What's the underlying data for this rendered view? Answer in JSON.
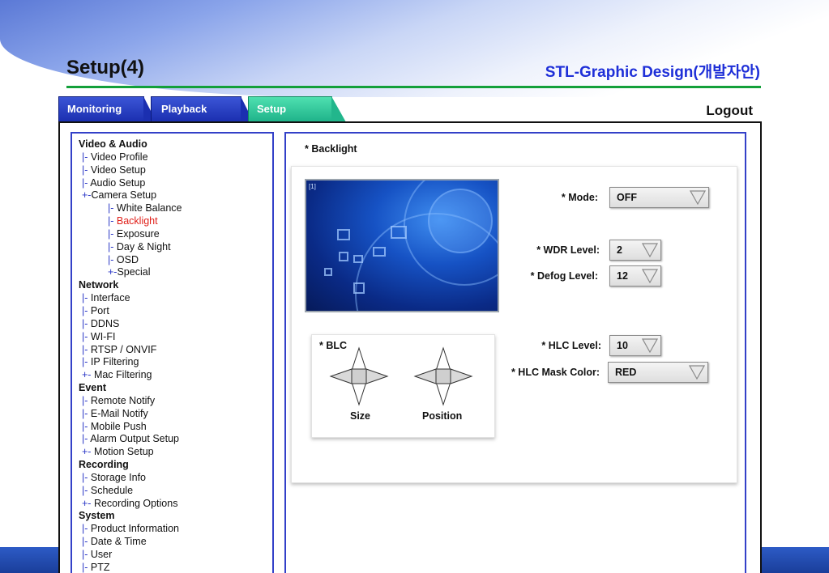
{
  "header": {
    "page_title": "Setup(4)",
    "brand_title": "STL-Graphic Design(개발자안)",
    "logout_label": "Logout"
  },
  "tabs": [
    {
      "label": "Monitoring"
    },
    {
      "label": "Playback"
    },
    {
      "label": "Setup",
      "active": true
    }
  ],
  "colors": {
    "tab_inactive": "#1b2fb0",
    "tab_active": "#22b68c",
    "accent_rule": "#13a03a",
    "panel_border": "#3340c8",
    "active_nav": "#e0201a"
  },
  "sidebar": {
    "items": [
      {
        "prefix": "",
        "label": "Video & Audio",
        "level": 0
      },
      {
        "prefix": "|- ",
        "label": "Video Profile",
        "level": 1
      },
      {
        "prefix": "|- ",
        "label": "Video Setup",
        "level": 1
      },
      {
        "prefix": "|- ",
        "label": "Audio Setup",
        "level": 1
      },
      {
        "prefix": "+-",
        "label": "Camera Setup",
        "level": 1
      },
      {
        "prefix": "|- ",
        "label": "White Balance",
        "level": 2
      },
      {
        "prefix": "|- ",
        "label": "Backlight",
        "level": 2,
        "active": true
      },
      {
        "prefix": "|- ",
        "label": "Exposure",
        "level": 2
      },
      {
        "prefix": "|- ",
        "label": "Day & Night",
        "level": 2
      },
      {
        "prefix": "|- ",
        "label": "OSD",
        "level": 2
      },
      {
        "prefix": "+-",
        "label": "Special",
        "level": 2
      },
      {
        "prefix": "",
        "label": "Network",
        "level": 0
      },
      {
        "prefix": "|- ",
        "label": "Interface",
        "level": 1
      },
      {
        "prefix": "|- ",
        "label": "Port",
        "level": 1
      },
      {
        "prefix": "|- ",
        "label": "DDNS",
        "level": 1
      },
      {
        "prefix": "|- ",
        "label": "WI-FI",
        "level": 1
      },
      {
        "prefix": "|- ",
        "label": "RTSP / ONVIF",
        "level": 1
      },
      {
        "prefix": "|- ",
        "label": "IP Filtering",
        "level": 1
      },
      {
        "prefix": "+- ",
        "label": "Mac Filtering",
        "level": 1
      },
      {
        "prefix": "",
        "label": "Event",
        "level": 0
      },
      {
        "prefix": "|- ",
        "label": "Remote Notify",
        "level": 1
      },
      {
        "prefix": "|- ",
        "label": "E-Mail Notify",
        "level": 1
      },
      {
        "prefix": "|- ",
        "label": "Mobile Push",
        "level": 1
      },
      {
        "prefix": "|- ",
        "label": "Alarm Output Setup",
        "level": 1
      },
      {
        "prefix": "+- ",
        "label": "Motion Setup",
        "level": 1
      },
      {
        "prefix": "",
        "label": "Recording",
        "level": 0
      },
      {
        "prefix": " |- ",
        "label": "Storage Info",
        "level": 1
      },
      {
        "prefix": " |- ",
        "label": "Schedule",
        "level": 1
      },
      {
        "prefix": "+- ",
        "label": "Recording Options",
        "level": 1
      },
      {
        "prefix": "",
        "label": "System",
        "level": 0
      },
      {
        "prefix": " |- ",
        "label": "Product Information",
        "level": 1
      },
      {
        "prefix": " |- ",
        "label": "Date & Time",
        "level": 1
      },
      {
        "prefix": " |- ",
        "label": "User",
        "level": 1
      },
      {
        "prefix": " |- ",
        "label": "PTZ",
        "level": 1
      }
    ]
  },
  "content": {
    "section_heading": "*  Backlight",
    "preview_label": "[1]",
    "mode": {
      "label": "*  Mode:",
      "value": "OFF"
    },
    "wdr": {
      "label": "*  WDR Level:",
      "value": "2"
    },
    "defog": {
      "label": "*  Defog Level:",
      "value": "12"
    },
    "hlc_level": {
      "label": "*  HLC Level:",
      "value": "10"
    },
    "hlc_mask": {
      "label": "*  HLC Mask Color:",
      "value": "RED"
    },
    "blc": {
      "label": "*  BLC",
      "size_label": "Size",
      "position_label": "Position"
    }
  }
}
